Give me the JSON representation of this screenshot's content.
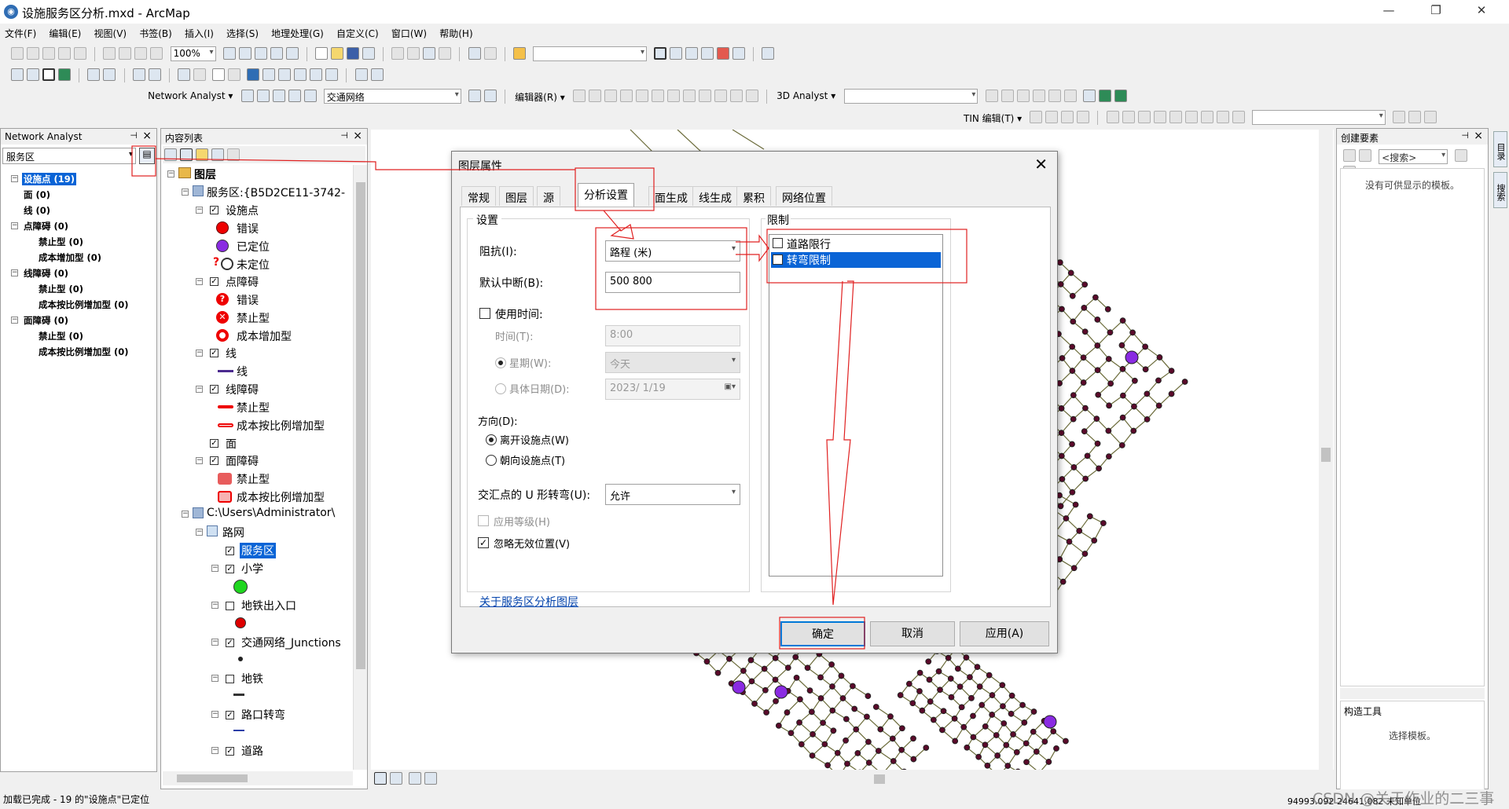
{
  "window": {
    "title": "设施服务区分析.mxd - ArcMap"
  },
  "menu": [
    "文件(F)",
    "编辑(E)",
    "视图(V)",
    "书签(B)",
    "插入(I)",
    "选择(S)",
    "地理处理(G)",
    "自定义(C)",
    "窗口(W)",
    "帮助(H)"
  ],
  "toolbar": {
    "zoom_value": "100%",
    "network_analyst": "Network Analyst ▾",
    "network_dataset": "交通网络",
    "editor": "编辑器(R) ▾",
    "analyst3d": "3D Analyst ▾",
    "tin_edit": "TIN 编辑(T) ▾"
  },
  "na_window": {
    "title": "Network Analyst",
    "combo": "服务区",
    "items": [
      {
        "label": "设施点 (19)",
        "level": 0,
        "selected": true
      },
      {
        "label": "面 (0)",
        "level": 1
      },
      {
        "label": "线 (0)",
        "level": 1
      },
      {
        "label": "点障碍 (0)",
        "level": 0
      },
      {
        "label": "禁止型 (0)",
        "level": 2
      },
      {
        "label": "成本增加型 (0)",
        "level": 2
      },
      {
        "label": "线障碍 (0)",
        "level": 0
      },
      {
        "label": "禁止型 (0)",
        "level": 2
      },
      {
        "label": "成本按比例增加型 (0)",
        "level": 2
      },
      {
        "label": "面障碍 (0)",
        "level": 0
      },
      {
        "label": "禁止型 (0)",
        "level": 2
      },
      {
        "label": "成本按比例增加型 (0)",
        "level": 2
      }
    ]
  },
  "toc": {
    "title": "内容列表",
    "items": {
      "layers": "图层",
      "service_area": "服务区:{B5D2CE11-3742-",
      "facilities": "设施点",
      "err1": "错误",
      "located": "已定位",
      "unlocated": "未定位",
      "point_barriers": "点障碍",
      "err2": "错误",
      "prohibit1": "禁止型",
      "cost_add": "成本增加型",
      "lines": "线",
      "line_sym": "线",
      "line_barriers": "线障碍",
      "prohibit2": "禁止型",
      "cost_scale1": "成本按比例增加型",
      "polygons": "面",
      "polygon_barriers": "面障碍",
      "prohibit3": "禁止型",
      "cost_scale2": "成本按比例增加型",
      "path": "C:\\Users\\Administrator\\",
      "road_net": "路网",
      "service_area2": "服务区",
      "school": "小学",
      "subway_exit": "地铁出入口",
      "junctions": "交通网络_Junctions",
      "subway": "地铁",
      "turns": "路口转弯",
      "roads": "道路"
    }
  },
  "dialog": {
    "title": "图层属性",
    "tabs": [
      "常规",
      "图层",
      "源",
      "分析设置",
      "面生成",
      "线生成",
      "累积",
      "网络位置"
    ],
    "settings_group": "设置",
    "impedance_label": "阻抗(I):",
    "impedance_value": "路程 (米)",
    "breaks_label": "默认中断(B):",
    "breaks_value": "500 800",
    "use_time": "使用时间:",
    "time_label": "时间(T):",
    "time_value": "8:00",
    "weekday_label": "星期(W):",
    "weekday_value": "今天",
    "date_label": "具体日期(D):",
    "date_value": "2023/ 1/19",
    "direction_label": "方向(D):",
    "dir_away": "离开设施点(W)",
    "dir_toward": "朝向设施点(T)",
    "uturn_label": "交汇点的 U 形转弯(U):",
    "uturn_value": "允许",
    "hierarchy": "应用等级(H)",
    "ignore_invalid": "忽略无效位置(V)",
    "restrictions_group": "限制",
    "restrictions": [
      "道路限行",
      "转弯限制"
    ],
    "help_link": "关于服务区分析图层",
    "ok": "确定",
    "cancel": "取消",
    "apply": "应用(A)"
  },
  "create_features": {
    "title": "创建要素",
    "search": "<搜索>",
    "empty_msg": "没有可供显示的模板。",
    "construct_tools": "构造工具",
    "select_template": "选择模板。"
  },
  "side_tabs": [
    "目录",
    "搜索"
  ],
  "status": {
    "message": "加载已完成 - 19 的\"设施点\"已定位",
    "coords": "94993.092  24641.082 未知单位",
    "watermark": "CSDN @关于作业的二三事"
  }
}
